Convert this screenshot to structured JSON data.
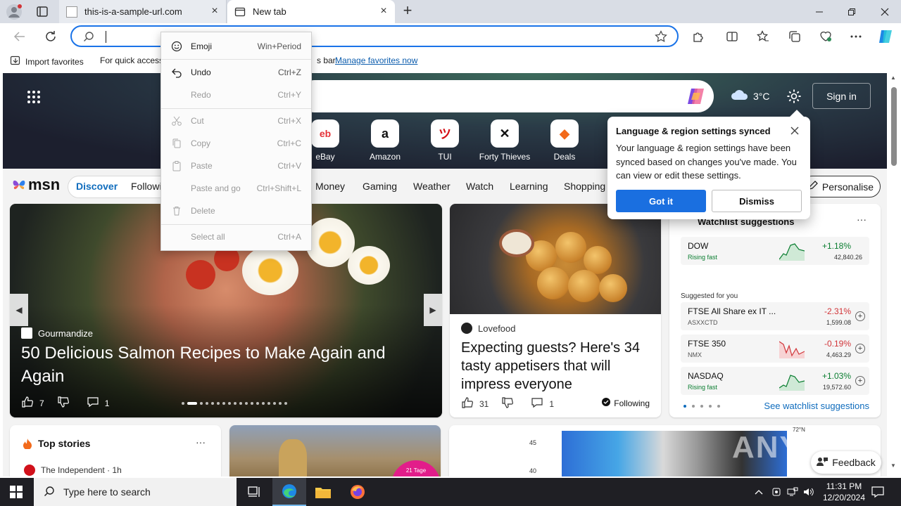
{
  "browser": {
    "tabs": [
      {
        "title": "this-is-a-sample-url.com"
      },
      {
        "title": "New tab"
      }
    ],
    "address": {
      "value": ""
    }
  },
  "favorites_bar": {
    "import_label": "Import favorites",
    "message_start": "For quick access",
    "message_end": "s bar.",
    "manage_link": "Manage favorites now"
  },
  "context_menu": {
    "items": [
      {
        "label": "Emoji",
        "shortcut": "Win+Period",
        "enabled": true
      },
      {
        "label": "Undo",
        "shortcut": "Ctrl+Z",
        "enabled": true
      },
      {
        "label": "Redo",
        "shortcut": "Ctrl+Y",
        "enabled": false
      },
      {
        "label": "Cut",
        "shortcut": "Ctrl+X",
        "enabled": false
      },
      {
        "label": "Copy",
        "shortcut": "Ctrl+C",
        "enabled": false
      },
      {
        "label": "Paste",
        "shortcut": "Ctrl+V",
        "enabled": false
      },
      {
        "label": "Paste and go",
        "shortcut": "Ctrl+Shift+L",
        "enabled": false
      },
      {
        "label": "Delete",
        "shortcut": "",
        "enabled": false
      },
      {
        "label": "Select all",
        "shortcut": "Ctrl+A",
        "enabled": false
      }
    ]
  },
  "msn": {
    "logo": "msn",
    "weather": {
      "temp": "3°C"
    },
    "signin": "Sign in",
    "quick_links": [
      {
        "label": "eBay",
        "glyph": "eb"
      },
      {
        "label": "Amazon",
        "glyph": "a"
      },
      {
        "label": "TUI",
        "glyph": "ツ"
      },
      {
        "label": "Forty Thieves",
        "glyph": "✕"
      },
      {
        "label": "Deals",
        "glyph": "◆"
      }
    ],
    "nav": {
      "discover": "Discover",
      "following": "Followi",
      "items": [
        "Money",
        "Gaming",
        "Weather",
        "Watch",
        "Learning",
        "Shopping"
      ],
      "personalise": "Personalise"
    },
    "hero": {
      "source": "Gourmandize",
      "title": "50 Delicious Salmon Recipes to Make Again and Again",
      "likes": "7",
      "comments": "1"
    },
    "food": {
      "source": "Lovefood",
      "title": "Expecting guests? Here's 34 tasty appetisers that will impress everyone",
      "likes": "31",
      "comments": "1",
      "following": "Following"
    },
    "watchlist": {
      "title": "Watchlist suggestions",
      "suggested_label": "Suggested for you",
      "see_all": "See watchlist suggestions",
      "stocks": [
        {
          "name": "DOW",
          "sub": "Rising fast",
          "change": "+1.18%",
          "price": "42,840.26",
          "trend": "up"
        },
        {
          "name": "FTSE All Share ex IT ...",
          "sub": "ASXXCTD",
          "change": "-2.31%",
          "price": "1,599.08",
          "trend": "down"
        },
        {
          "name": "FTSE 350",
          "sub": "NMX",
          "change": "-0.19%",
          "price": "4,463.29",
          "trend": "down"
        },
        {
          "name": "NASDAQ",
          "sub": "Rising fast",
          "change": "+1.03%",
          "price": "19,572.60",
          "trend": "up"
        }
      ]
    },
    "top_stories": {
      "title": "Top stories",
      "source": "The Independent · 1h"
    },
    "cheetah_badge": "21 Tage",
    "map_axis": [
      "45",
      "40"
    ],
    "map_label": "72°N",
    "feedback": "Feedback"
  },
  "popup": {
    "title": "Language & region settings synced",
    "body": "Your language & region settings have been synced based on changes you've made. You can view or edit these settings.",
    "primary": "Got it",
    "secondary": "Dismiss"
  },
  "taskbar": {
    "search_placeholder": "Type here to search",
    "time": "11:31 PM",
    "date": "12/20/2024"
  },
  "watermark": "ANY RUN",
  "colors": {
    "accent": "#1a6fe0",
    "positive": "#0a7d30",
    "negative": "#d13438",
    "taskbar": "#1f1f24"
  }
}
